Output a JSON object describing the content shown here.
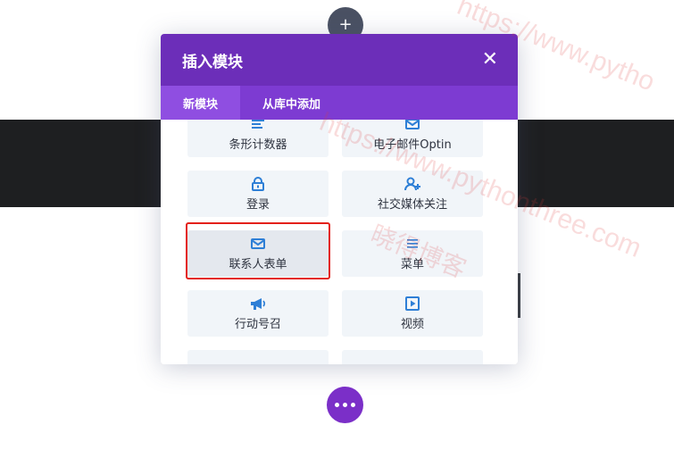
{
  "modal": {
    "title": "插入模块",
    "close_symbol": "✕",
    "tabs": [
      {
        "label": "新模块",
        "active": true
      },
      {
        "label": "从库中添加",
        "active": false
      }
    ]
  },
  "modules": [
    {
      "label": "条形计数器",
      "icon": "bar-counter-icon"
    },
    {
      "label": "电子邮件Optin",
      "icon": "email-icon"
    },
    {
      "label": "登录",
      "icon": "lock-icon"
    },
    {
      "label": "社交媒体关注",
      "icon": "user-add-icon"
    },
    {
      "label": "联系人表单",
      "icon": "envelope-icon"
    },
    {
      "label": "菜单",
      "icon": "menu-icon"
    },
    {
      "label": "行动号召",
      "icon": "megaphone-icon"
    },
    {
      "label": "视频",
      "icon": "play-icon"
    },
    {
      "label": "",
      "icon": "module-icon"
    },
    {
      "label": "",
      "icon": "module-icon"
    }
  ],
  "top_button": {
    "symbol": "+"
  },
  "watermark": {
    "url": "https://www.pythonthree.com",
    "url_top": "https://www.pytho",
    "text": "晓得博客"
  },
  "colors": {
    "header": "#6c2eb9",
    "tab_bar": "#7d3bd2",
    "accent_blue": "#2e7fd6",
    "highlight": "#e32019",
    "more_button": "#7b2fc8"
  }
}
